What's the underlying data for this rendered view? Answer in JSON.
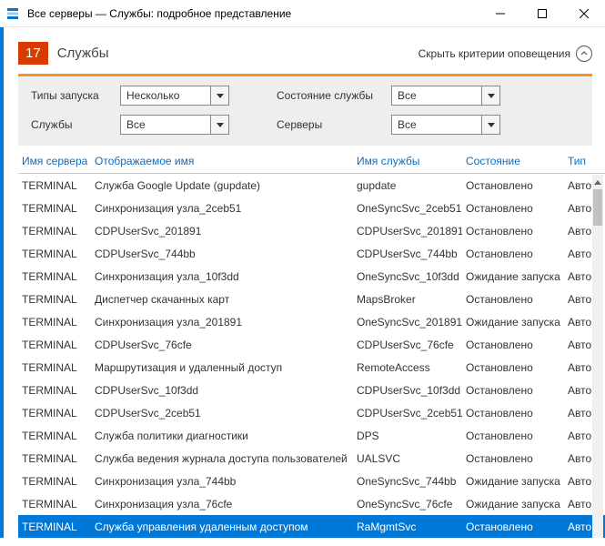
{
  "window": {
    "title": "Все серверы — Службы: подробное представление"
  },
  "header": {
    "count": "17",
    "label": "Службы",
    "hide_criteria": "Скрыть критерии оповещения"
  },
  "filters": {
    "startup_label": "Типы запуска",
    "startup_value": "Несколько",
    "state_label": "Состояние службы",
    "state_value": "Все",
    "services_label": "Службы",
    "services_value": "Все",
    "servers_label": "Серверы",
    "servers_value": "Все"
  },
  "table": {
    "headers": {
      "server": "Имя сервера",
      "display": "Отображаемое имя",
      "svc": "Имя службы",
      "state": "Состояние",
      "type": "Тип"
    },
    "rows": [
      {
        "server": "TERMINAL",
        "display": "Служба Google Update (gupdate)",
        "svc": "gupdate",
        "state": "Остановлено",
        "type": "Авто"
      },
      {
        "server": "TERMINAL",
        "display": "Синхронизация узла_2ceb51",
        "svc": "OneSyncSvc_2ceb51",
        "state": "Остановлено",
        "type": "Авто"
      },
      {
        "server": "TERMINAL",
        "display": "CDPUserSvc_201891",
        "svc": "CDPUserSvc_201891",
        "state": "Остановлено",
        "type": "Авто"
      },
      {
        "server": "TERMINAL",
        "display": "CDPUserSvc_744bb",
        "svc": "CDPUserSvc_744bb",
        "state": "Остановлено",
        "type": "Авто"
      },
      {
        "server": "TERMINAL",
        "display": "Синхронизация узла_10f3dd",
        "svc": "OneSyncSvc_10f3dd",
        "state": "Ожидание запуска",
        "type": "Авто"
      },
      {
        "server": "TERMINAL",
        "display": "Диспетчер скачанных карт",
        "svc": "MapsBroker",
        "state": "Остановлено",
        "type": "Авто"
      },
      {
        "server": "TERMINAL",
        "display": "Синхронизация узла_201891",
        "svc": "OneSyncSvc_201891",
        "state": "Ожидание запуска",
        "type": "Авто"
      },
      {
        "server": "TERMINAL",
        "display": "CDPUserSvc_76cfe",
        "svc": "CDPUserSvc_76cfe",
        "state": "Остановлено",
        "type": "Авто"
      },
      {
        "server": "TERMINAL",
        "display": "Маршрутизация и удаленный доступ",
        "svc": "RemoteAccess",
        "state": "Остановлено",
        "type": "Авто"
      },
      {
        "server": "TERMINAL",
        "display": "CDPUserSvc_10f3dd",
        "svc": "CDPUserSvc_10f3dd",
        "state": "Остановлено",
        "type": "Авто"
      },
      {
        "server": "TERMINAL",
        "display": "CDPUserSvc_2ceb51",
        "svc": "CDPUserSvc_2ceb51",
        "state": "Остановлено",
        "type": "Авто"
      },
      {
        "server": "TERMINAL",
        "display": "Служба политики диагностики",
        "svc": "DPS",
        "state": "Остановлено",
        "type": "Авто"
      },
      {
        "server": "TERMINAL",
        "display": "Служба ведения журнала доступа пользователей",
        "svc": "UALSVC",
        "state": "Остановлено",
        "type": "Авто"
      },
      {
        "server": "TERMINAL",
        "display": "Синхронизация узла_744bb",
        "svc": "OneSyncSvc_744bb",
        "state": "Ожидание запуска",
        "type": "Авто"
      },
      {
        "server": "TERMINAL",
        "display": "Синхронизация узла_76cfe",
        "svc": "OneSyncSvc_76cfe",
        "state": "Ожидание запуска",
        "type": "Авто"
      },
      {
        "server": "TERMINAL",
        "display": "Служба управления удаленным доступом",
        "svc": "RaMgmtSvc",
        "state": "Остановлено",
        "type": "Авто",
        "selected": true
      }
    ]
  }
}
